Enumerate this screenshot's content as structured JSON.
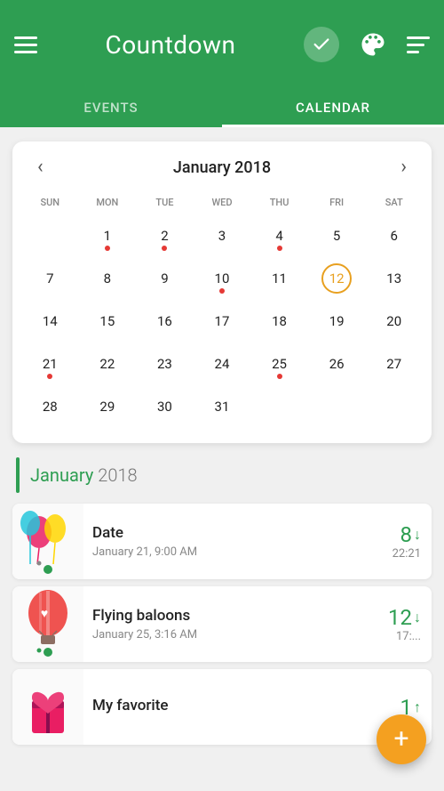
{
  "header": {
    "title": "Countdown",
    "hamburger_label": "Menu",
    "check_label": "Check",
    "palette_label": "Palette",
    "sort_label": "Sort"
  },
  "tabs": [
    {
      "id": "events",
      "label": "EVENTS",
      "active": false
    },
    {
      "id": "calendar",
      "label": "CALENDAR",
      "active": true
    }
  ],
  "calendar": {
    "month_year": "January 2018",
    "prev_label": "‹",
    "next_label": "›",
    "weekdays": [
      "SUN",
      "MON",
      "TUE",
      "WED",
      "THU",
      "FRI",
      "SAT"
    ],
    "days": [
      {
        "num": "",
        "empty": true,
        "dot": false,
        "today": false
      },
      {
        "num": "1",
        "dot": true,
        "today": false
      },
      {
        "num": "2",
        "dot": true,
        "today": false
      },
      {
        "num": "3",
        "dot": false,
        "today": false
      },
      {
        "num": "4",
        "dot": true,
        "today": false
      },
      {
        "num": "5",
        "dot": false,
        "today": false
      },
      {
        "num": "6",
        "dot": false,
        "today": false
      },
      {
        "num": "7",
        "dot": false,
        "today": false
      },
      {
        "num": "8",
        "dot": false,
        "today": false
      },
      {
        "num": "9",
        "dot": false,
        "today": false
      },
      {
        "num": "10",
        "dot": true,
        "today": false
      },
      {
        "num": "11",
        "dot": false,
        "today": false
      },
      {
        "num": "12",
        "dot": false,
        "today": true
      },
      {
        "num": "13",
        "dot": false,
        "today": false
      },
      {
        "num": "14",
        "dot": false,
        "today": false
      },
      {
        "num": "15",
        "dot": false,
        "today": false
      },
      {
        "num": "16",
        "dot": false,
        "today": false
      },
      {
        "num": "17",
        "dot": false,
        "today": false
      },
      {
        "num": "18",
        "dot": false,
        "today": false
      },
      {
        "num": "19",
        "dot": false,
        "today": false
      },
      {
        "num": "20",
        "dot": false,
        "today": false
      },
      {
        "num": "21",
        "dot": true,
        "today": false
      },
      {
        "num": "22",
        "dot": false,
        "today": false
      },
      {
        "num": "23",
        "dot": false,
        "today": false
      },
      {
        "num": "24",
        "dot": false,
        "today": false
      },
      {
        "num": "25",
        "dot": true,
        "today": false
      },
      {
        "num": "26",
        "dot": false,
        "today": false
      },
      {
        "num": "27",
        "dot": false,
        "today": false
      },
      {
        "num": "28",
        "dot": false,
        "today": false
      },
      {
        "num": "29",
        "dot": false,
        "today": false
      },
      {
        "num": "30",
        "dot": false,
        "today": false
      },
      {
        "num": "31",
        "dot": false,
        "today": false
      }
    ]
  },
  "events_section": {
    "month": "January",
    "year": "2018",
    "items": [
      {
        "id": "date-event",
        "name": "Date",
        "date": "January 21, 9:00 AM",
        "days": "8",
        "direction": "↓",
        "time": "22:21",
        "emoji": "🎈",
        "dot": true
      },
      {
        "id": "flying-balloons",
        "name": "Flying baloons",
        "date": "January 25, 3:16 AM",
        "days": "12",
        "direction": "↓",
        "time": "17:...",
        "emoji": "🎈",
        "dot": true
      },
      {
        "id": "my-favorite",
        "name": "My favorite",
        "date": "",
        "days": "1",
        "direction": "↑",
        "time": "",
        "emoji": "💝",
        "dot": false
      }
    ]
  },
  "fab": {
    "label": "+",
    "aria": "Add event"
  }
}
